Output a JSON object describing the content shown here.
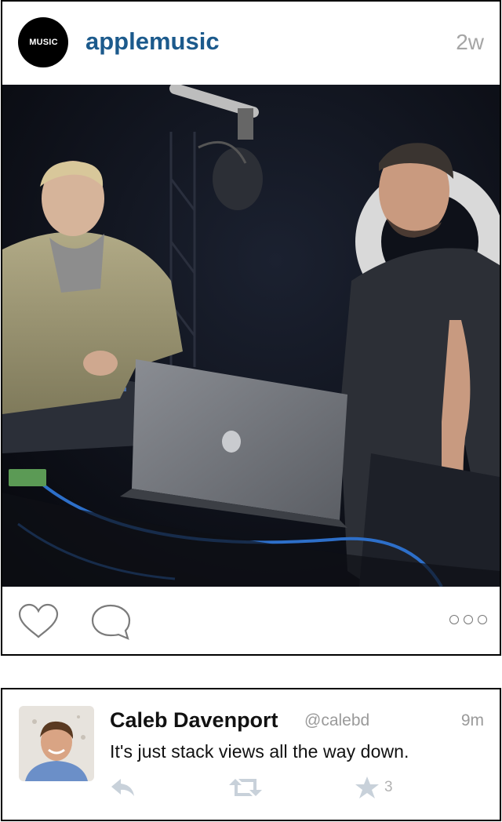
{
  "instagram_post": {
    "avatar_text": "MUSIC",
    "avatar_logo": "apple-logo-icon",
    "username": "applemusic",
    "age": "2w",
    "icons": [
      "heart-icon",
      "comment-icon",
      "more-dots-icon"
    ]
  },
  "tweet": {
    "name": "Caleb Davenport",
    "handle": "@calebd",
    "time": "9m",
    "text": "It's just stack views all the way down.",
    "favorite_count": "3",
    "icons": [
      "reply-icon",
      "retweet-icon",
      "star-icon"
    ]
  },
  "colors": {
    "username_blue": "#1c5a8c",
    "muted_gray": "#9a9a9a",
    "action_gray": "#c8d1da"
  }
}
